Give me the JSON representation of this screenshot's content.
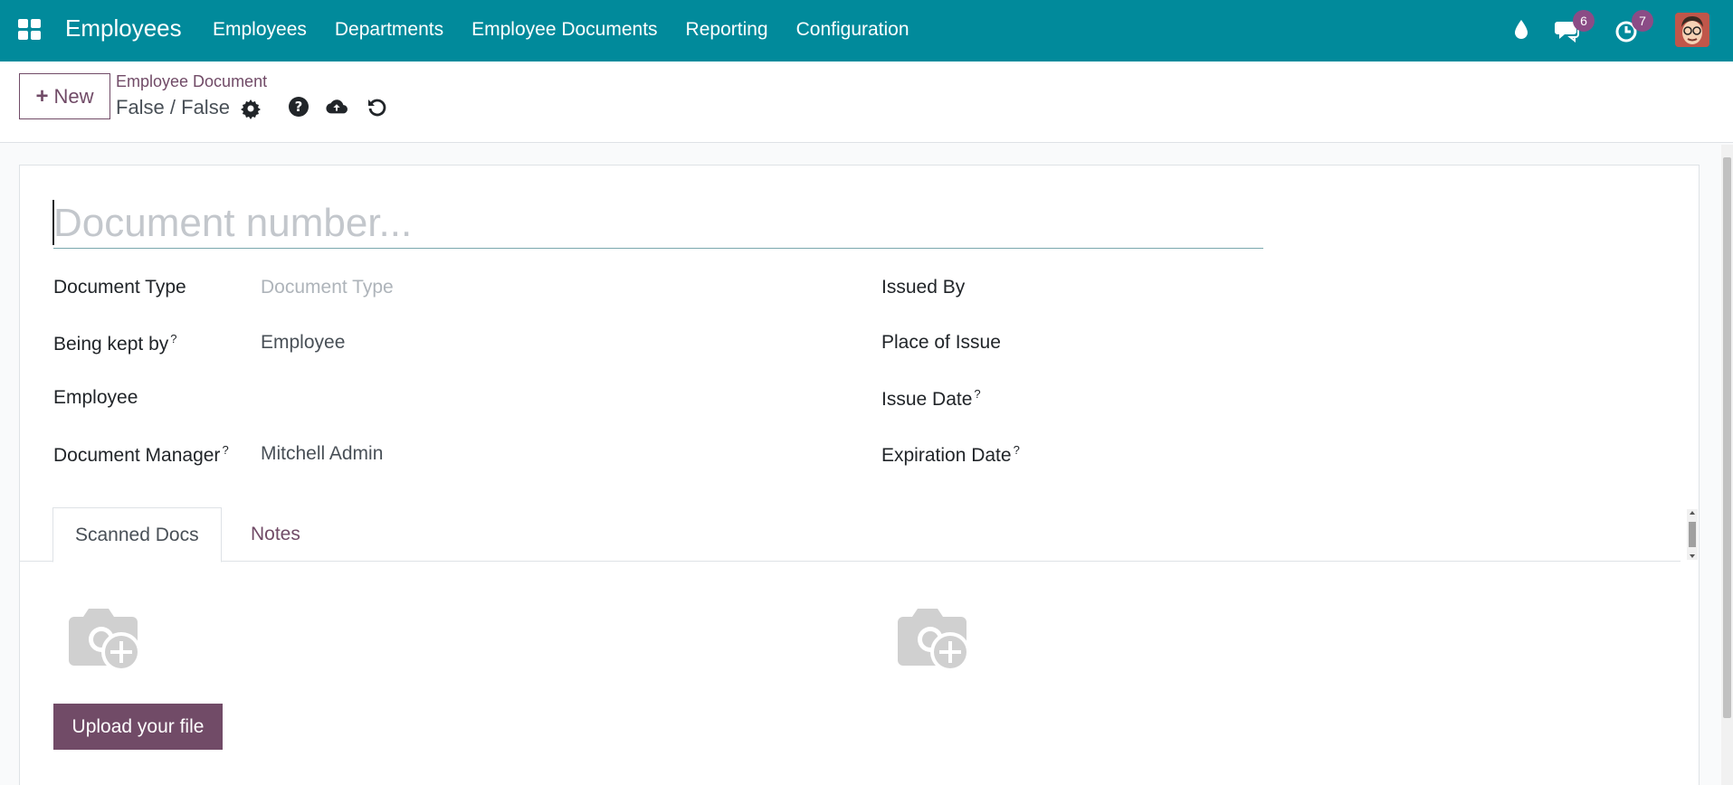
{
  "navbar": {
    "app_name": "Employees",
    "menu": [
      "Employees",
      "Departments",
      "Employee Documents",
      "Reporting",
      "Configuration"
    ],
    "messages_count": "6",
    "activities_count": "7",
    "icons": [
      "apps-grid-icon",
      "drop-icon",
      "chat-icon",
      "clock-icon"
    ],
    "bg_color": "#018a9b"
  },
  "control": {
    "new_label": "New",
    "breadcrumb": "Employee Document",
    "record_title": "False / False",
    "icons": [
      "gear-icon",
      "help-icon",
      "cloud-upload-icon",
      "undo-icon"
    ]
  },
  "form": {
    "document_number_placeholder": "Document number...",
    "left": {
      "document_type_label": "Document Type",
      "document_type_placeholder": "Document Type",
      "kept_by_label": "Being kept by",
      "kept_by_value": "Employee",
      "employee_label": "Employee",
      "manager_label": "Document Manager",
      "manager_value": "Mitchell Admin"
    },
    "right": {
      "issued_by_label": "Issued By",
      "place_label": "Place of Issue",
      "issue_date_label": "Issue Date",
      "expiration_label": "Expiration Date"
    },
    "help_mark": "?"
  },
  "tabs": [
    "Scanned Docs",
    "Notes"
  ],
  "upload": {
    "button_label": "Upload your file"
  },
  "colors": {
    "primary": "#714b67",
    "badge": "#8b4c86"
  }
}
